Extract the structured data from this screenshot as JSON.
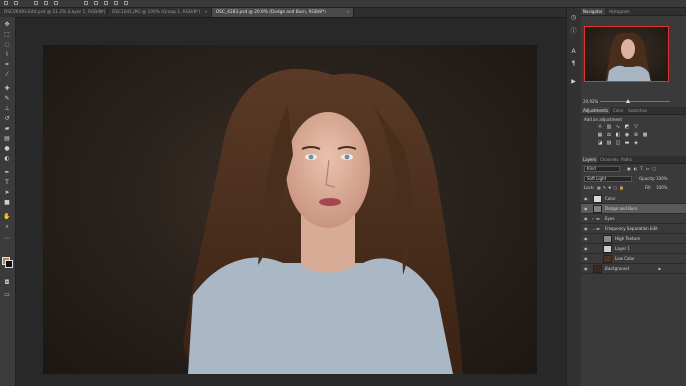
{
  "document_tabs": [
    {
      "label": "DSC06493.Edit.psd @ 51.2% (Layer 1, RGB/8*)",
      "active": false
    },
    {
      "label": "DSC1041.JPG @ 100% (Group 1, RGB/8*)",
      "active": false
    },
    {
      "label": "DSC_4283.psd @ 20.9% (Dodge and Burn, RGB/8*)",
      "active": true
    }
  ],
  "tab_close_glyph": "×",
  "tools": [
    "move-tool",
    "marquee-tool",
    "lasso-tool",
    "quick-select-tool",
    "crop-tool",
    "eyedropper-tool",
    "healing-brush-tool",
    "brush-tool",
    "clone-stamp-tool",
    "history-brush-tool",
    "eraser-tool",
    "gradient-tool",
    "blur-tool",
    "dodge-tool",
    "pen-tool",
    "type-tool",
    "path-select-tool",
    "rectangle-tool",
    "hand-tool",
    "zoom-tool"
  ],
  "colors": {
    "foreground": "#b08a5a",
    "background": "#111111",
    "accent_selection": "#e03030"
  },
  "navigator": {
    "tabs": [
      {
        "label": "Navigator",
        "active": true
      },
      {
        "label": "Histogram",
        "active": false
      }
    ],
    "zoom": "20.93%"
  },
  "adjustments": {
    "tabs": [
      {
        "label": "Adjustments",
        "active": true
      },
      {
        "label": "Color",
        "active": false
      },
      {
        "label": "Swatches",
        "active": false
      }
    ],
    "title": "Add an adjustment"
  },
  "layers": {
    "tabs": [
      {
        "label": "Layers",
        "active": true
      },
      {
        "label": "Channels",
        "active": false
      },
      {
        "label": "Paths",
        "active": false
      }
    ],
    "filter": "Kind",
    "blend_mode": "Soft Light",
    "opacity_label": "Opacity:",
    "opacity_value": "100%",
    "lock_label": "Lock:",
    "fill_label": "Fill:",
    "fill_value": "100%",
    "items": [
      {
        "name": "Color",
        "type": "layer",
        "selected": false
      },
      {
        "name": "Dodge and Burn",
        "type": "layer",
        "selected": true
      },
      {
        "name": "Eyes",
        "type": "group",
        "selected": false
      },
      {
        "name": "Frequency Separation Edit",
        "type": "group",
        "selected": false
      },
      {
        "name": "High Texture",
        "type": "layer",
        "selected": false
      },
      {
        "name": "Layer 1",
        "type": "layer",
        "selected": false
      },
      {
        "name": "Low Color",
        "type": "layer",
        "selected": false
      },
      {
        "name": "Background",
        "type": "layer",
        "selected": false
      }
    ]
  }
}
